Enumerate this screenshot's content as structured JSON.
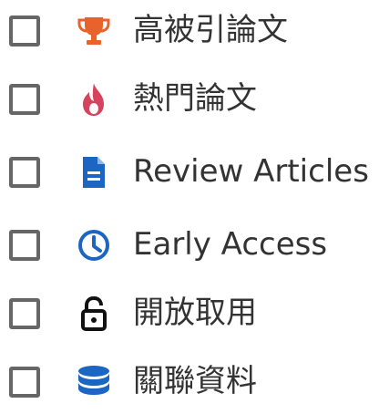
{
  "filters": {
    "items": [
      {
        "label": "高被引論文",
        "icon": "trophy-icon",
        "icon_color": "#e8632b",
        "checked": false
      },
      {
        "label": "熱門論文",
        "icon": "flame-icon",
        "icon_color": "#d6435f",
        "checked": false
      },
      {
        "label": "Review Articles",
        "icon": "document-icon",
        "icon_color": "#1a66c2",
        "checked": false
      },
      {
        "label": "Early Access",
        "icon": "clock-icon",
        "icon_color": "#1a66c2",
        "checked": false
      },
      {
        "label": "開放取用",
        "icon": "unlock-icon",
        "icon_color": "#111111",
        "checked": false
      },
      {
        "label": "關聯資料",
        "icon": "database-icon",
        "icon_color": "#1a66c2",
        "checked": false
      }
    ]
  }
}
